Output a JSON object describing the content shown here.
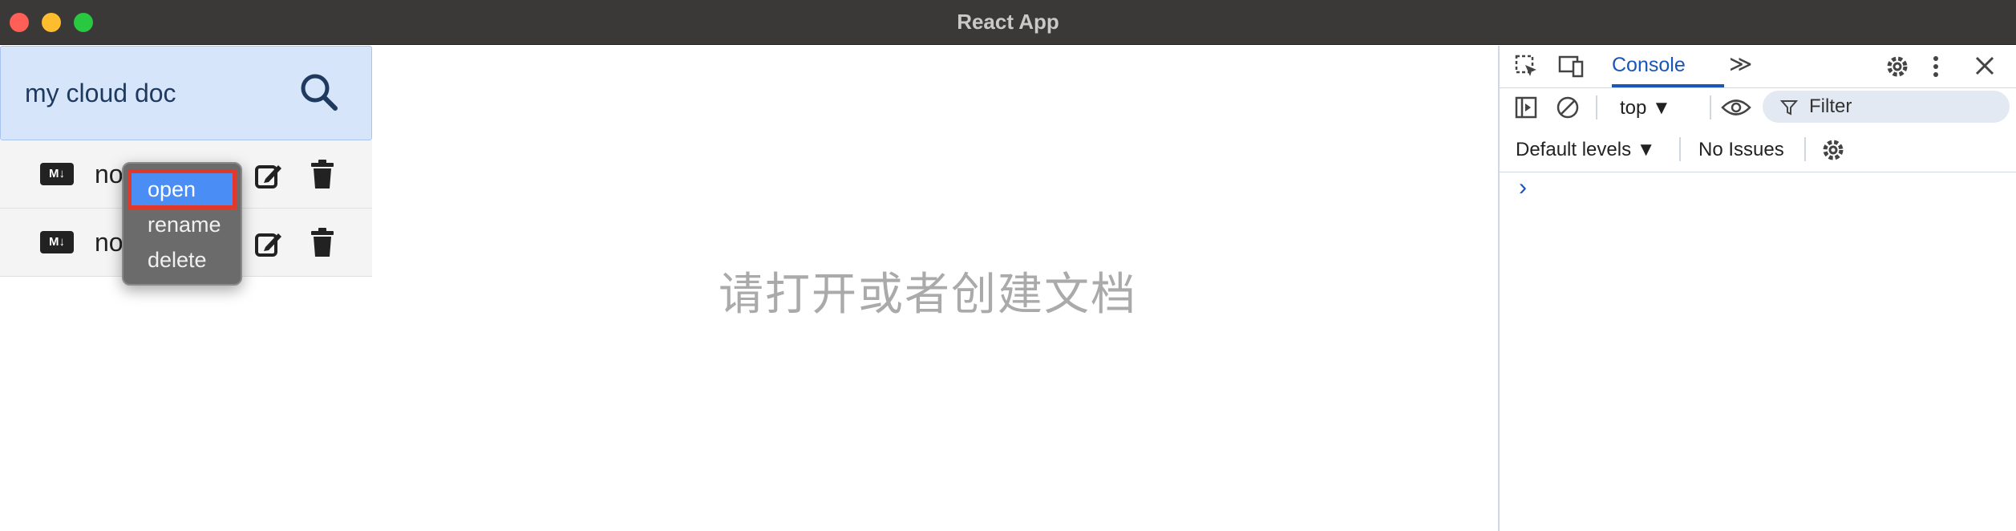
{
  "window": {
    "title": "React App"
  },
  "sidebar": {
    "search_title": "my cloud doc",
    "files": [
      {
        "badge": "M↓",
        "name": "no"
      },
      {
        "badge": "M↓",
        "name": "no"
      }
    ]
  },
  "context_menu": {
    "items": [
      "open",
      "rename",
      "delete"
    ],
    "selected": "open"
  },
  "main": {
    "empty_text": "请打开或者创建文档"
  },
  "devtools": {
    "tab": "Console",
    "more": "≫",
    "context_select": "top ▼",
    "filter_placeholder": "Filter",
    "levels": "Default levels ▼",
    "issues": "No Issues",
    "prompt": "›"
  },
  "colors": {
    "accent": "#1a56b7",
    "selection": "#4a8ef5",
    "highlight": "#e0392b",
    "search_bg": "#d7e5fb"
  }
}
